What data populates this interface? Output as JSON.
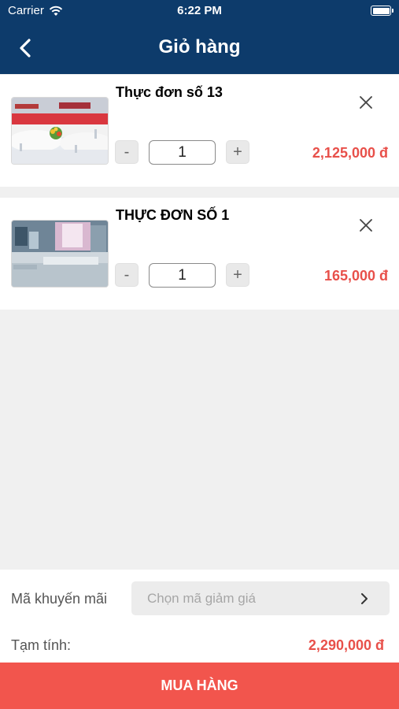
{
  "status_bar": {
    "carrier": "Carrier",
    "time": "6:22 PM"
  },
  "header": {
    "title": "Giỏ hàng",
    "back_icon": "chevron-left-icon"
  },
  "cart_items": [
    {
      "name": "Thực đơn số 13",
      "quantity": "1",
      "price": "2,125,000 đ",
      "image": "banquet-table-photo"
    },
    {
      "name": "THỰC ĐƠN SỐ 1",
      "quantity": "1",
      "price": "165,000 đ",
      "image": "buffet-hall-photo"
    }
  ],
  "qty_controls": {
    "minus": "-",
    "plus": "+"
  },
  "promo": {
    "label": "Mã khuyến mãi",
    "placeholder": "Chọn mã giảm giá"
  },
  "subtotal": {
    "label": "Tạm tính:",
    "value": "2,290,000 đ"
  },
  "buy_button": {
    "label": "MUA HÀNG"
  },
  "colors": {
    "header": "#0d3b6b",
    "accent": "#f2554d",
    "price": "#e8504a"
  }
}
